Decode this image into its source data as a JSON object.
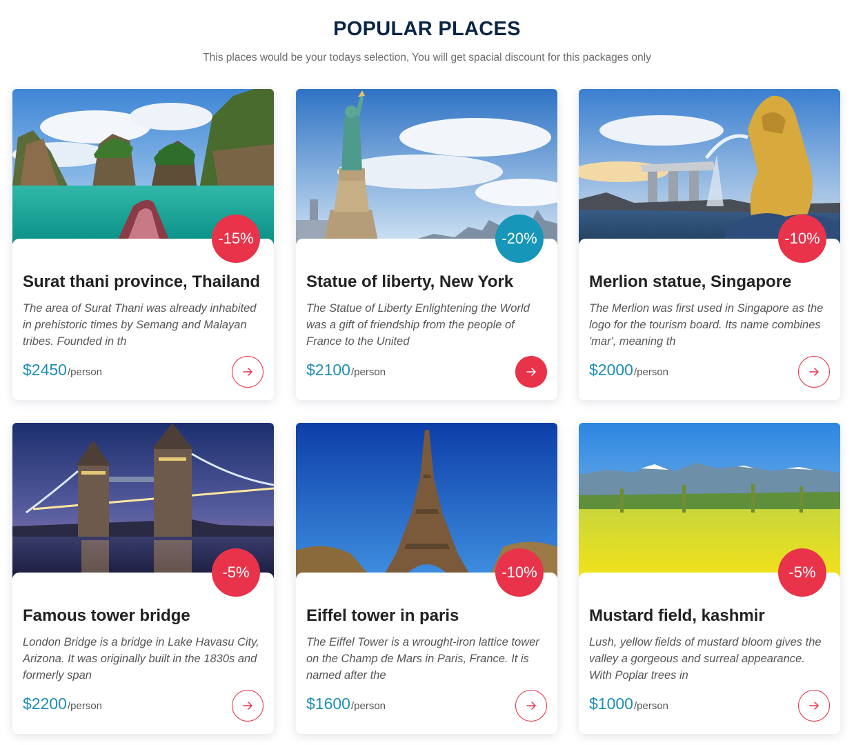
{
  "header": {
    "title": "POPULAR PLACES",
    "subtitle": "This places would be your todays selection, You will get spacial discount for this packages only"
  },
  "colors": {
    "accent_red": "#e8334a",
    "accent_blue": "#1696b8",
    "price": "#1d8fb3",
    "title": "#0b2545"
  },
  "cards": [
    {
      "title": "Surat thani province, Thailand",
      "description": "The area of Surat Thani was already inhabited in prehistoric times by Semang and Malayan tribes. Founded in th",
      "price": "$2450",
      "per": "/person",
      "discount": "-15%",
      "badge_color": "red",
      "button_filled": false,
      "image": "thailand-lagoon-photo"
    },
    {
      "title": "Statue of liberty, New York",
      "description": "The Statue of Liberty Enlightening the World was a gift of friendship from the people of France to the United",
      "price": "$2100",
      "per": "/person",
      "discount": "-20%",
      "badge_color": "blue",
      "button_filled": true,
      "image": "statue-of-liberty-photo"
    },
    {
      "title": "Merlion statue, Singapore",
      "description": "The Merlion was first used in Singapore as the logo for the tourism board. Its name combines 'mar', meaning th",
      "price": "$2000",
      "per": "/person",
      "discount": "-10%",
      "badge_color": "red",
      "button_filled": false,
      "image": "merlion-photo"
    },
    {
      "title": "Famous tower bridge",
      "description": "London Bridge is a bridge in Lake Havasu City, Arizona. It was originally built in the 1830s and formerly span",
      "price": "$2200",
      "per": "/person",
      "discount": "-5%",
      "badge_color": "red",
      "button_filled": false,
      "image": "tower-bridge-photo"
    },
    {
      "title": "Eiffel tower in paris",
      "description": "The Eiffel Tower is a wrought-iron lattice tower on the Champ de Mars in Paris, France. It is named after the",
      "price": "$1600",
      "per": "/person",
      "discount": "-10%",
      "badge_color": "red",
      "button_filled": false,
      "image": "eiffel-tower-photo"
    },
    {
      "title": "Mustard field, kashmir",
      "description": "Lush, yellow fields of mustard bloom gives the valley a gorgeous and surreal appearance. With Poplar trees in",
      "price": "$1000",
      "per": "/person",
      "discount": "-5%",
      "badge_color": "red",
      "button_filled": false,
      "image": "mustard-field-photo"
    }
  ]
}
